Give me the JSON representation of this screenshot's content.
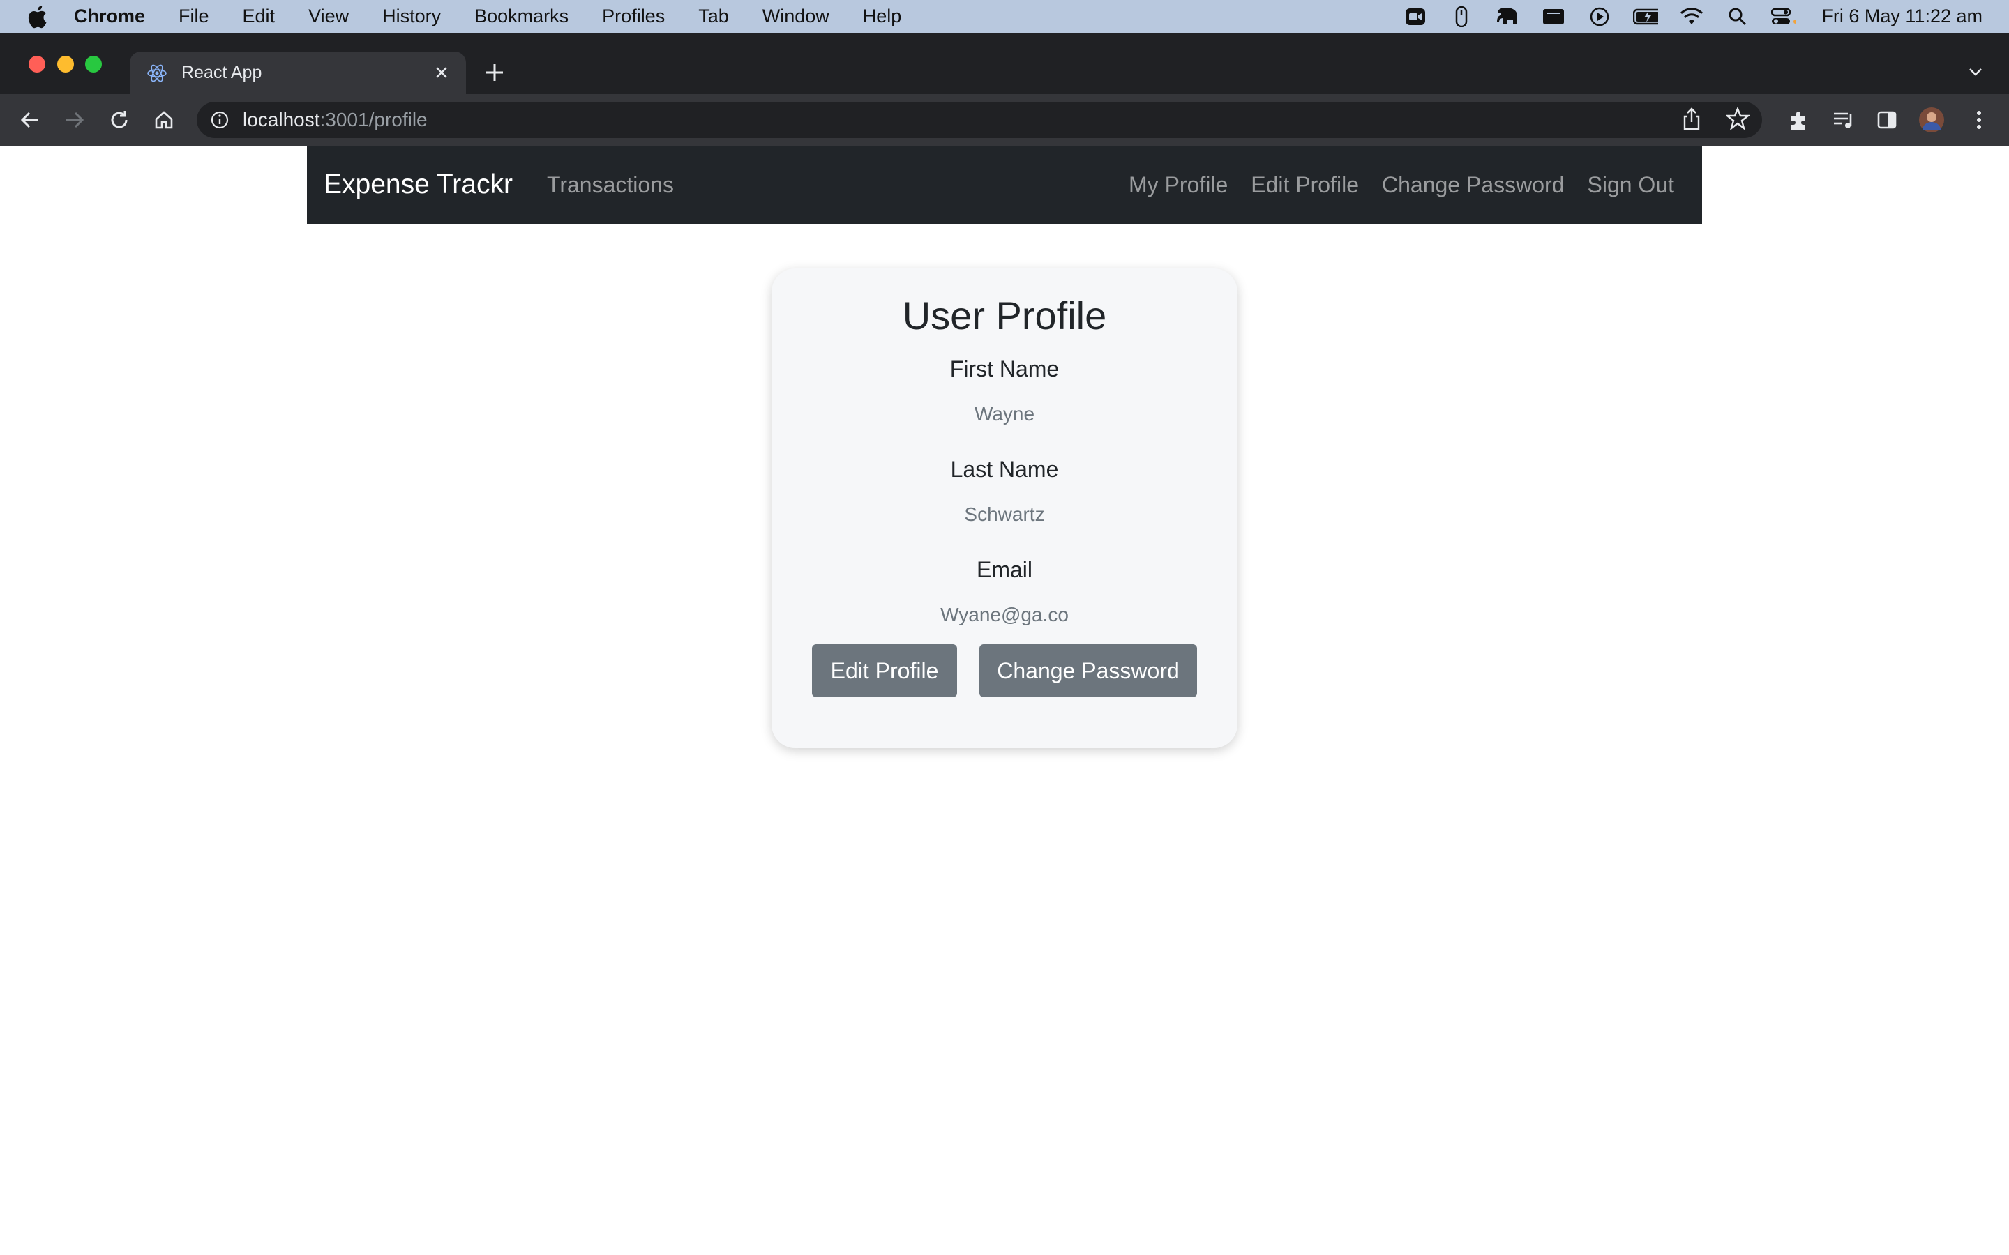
{
  "menubar": {
    "app_name": "Chrome",
    "items": [
      "File",
      "Edit",
      "View",
      "History",
      "Bookmarks",
      "Profiles",
      "Tab",
      "Window",
      "Help"
    ],
    "clock": "Fri 6 May  11:22 am"
  },
  "browser": {
    "tab_title": "React App",
    "url_host": "localhost",
    "url_path": ":3001/profile"
  },
  "navbar": {
    "brand": "Expense Trackr",
    "left_link": "Transactions",
    "right_links": [
      "My Profile",
      "Edit Profile",
      "Change Password",
      "Sign Out"
    ],
    "background": "#212529"
  },
  "profile": {
    "title": "User Profile",
    "first_name_label": "First Name",
    "first_name_value": "Wayne",
    "last_name_label": "Last Name",
    "last_name_value": "Schwartz",
    "email_label": "Email",
    "email_value": "Wyane@ga.co",
    "edit_button": "Edit Profile",
    "change_password_button": "Change Password",
    "button_color": "#6c757d"
  }
}
